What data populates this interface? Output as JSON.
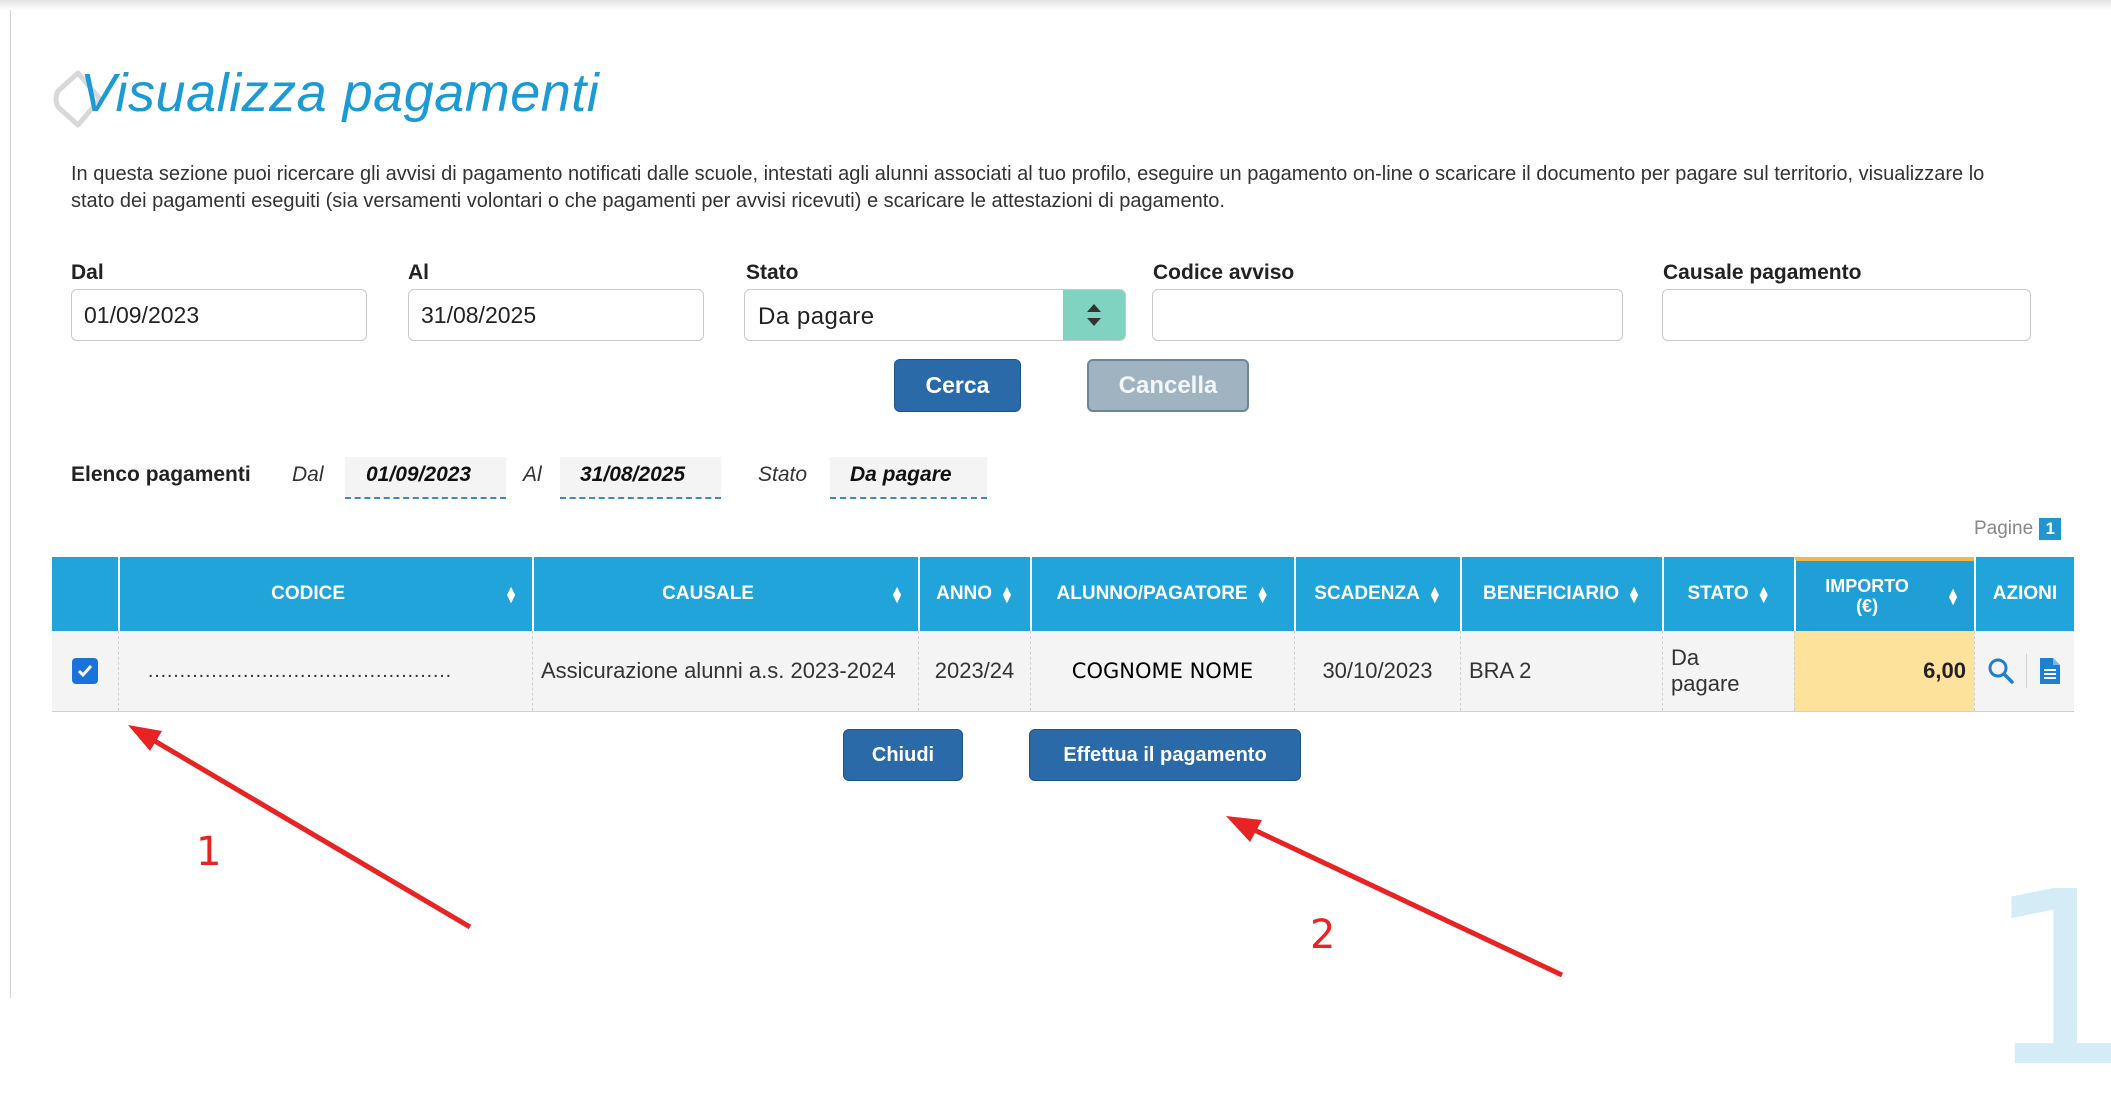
{
  "page": {
    "title": "Visualizza pagamenti",
    "intro": "In questa sezione puoi ricercare gli avvisi di pagamento notificati dalle scuole, intestati agli alunni associati al tuo profilo, eseguire un pagamento on-line o scaricare il documento per pagare sul territorio, visualizzare lo stato dei pagamenti eseguiti (sia versamenti volontari o che pagamenti per avvisi ricevuti) e scaricare le attestazioni di pagamento."
  },
  "filters": {
    "dal": {
      "label": "Dal",
      "value": "01/09/2023"
    },
    "al": {
      "label": "Al",
      "value": "31/08/2025"
    },
    "stato": {
      "label": "Stato",
      "value": "Da pagare"
    },
    "codice_avviso": {
      "label": "Codice avviso",
      "value": ""
    },
    "causale": {
      "label": "Causale pagamento",
      "value": ""
    },
    "cerca_label": "Cerca",
    "cancella_label": "Cancella"
  },
  "elenco": {
    "label": "Elenco pagamenti",
    "dal_label": "Dal",
    "dal_value": "01/09/2023",
    "al_label": "Al",
    "al_value": "31/08/2025",
    "stato_label": "Stato",
    "stato_value": "Da pagare"
  },
  "pagination": {
    "label": "Pagine",
    "current": "1"
  },
  "table": {
    "columns": [
      "CODICE",
      "CAUSALE",
      "ANNO",
      "ALUNNO/PAGATORE",
      "SCADENZA",
      "BENEFICIARIO",
      "STATO",
      "IMPORTO (€)",
      "AZIONI"
    ],
    "importo_line1": "IMPORTO",
    "importo_line2": "(€)",
    "rows": [
      {
        "selected": true,
        "codice": "…………………………………………",
        "causale": "Assicurazione alunni a.s. 2023-2024",
        "anno": "2023/24",
        "alunno": "COGNOME NOME",
        "scadenza": "30/10/2023",
        "beneficiario": "BRA 2",
        "stato": "Da pagare",
        "importo": "6,00"
      }
    ]
  },
  "actions": {
    "chiudi_label": "Chiudi",
    "paga_label": "Effettua il pagamento"
  },
  "annotations": {
    "one": "1",
    "two": "2"
  },
  "watermark": "1",
  "colors": {
    "accent": "#20a4d9",
    "button": "#2a6aa8",
    "importo_bg": "#fce29b",
    "annotation": "#e82323",
    "title": "#1b9ad3"
  }
}
